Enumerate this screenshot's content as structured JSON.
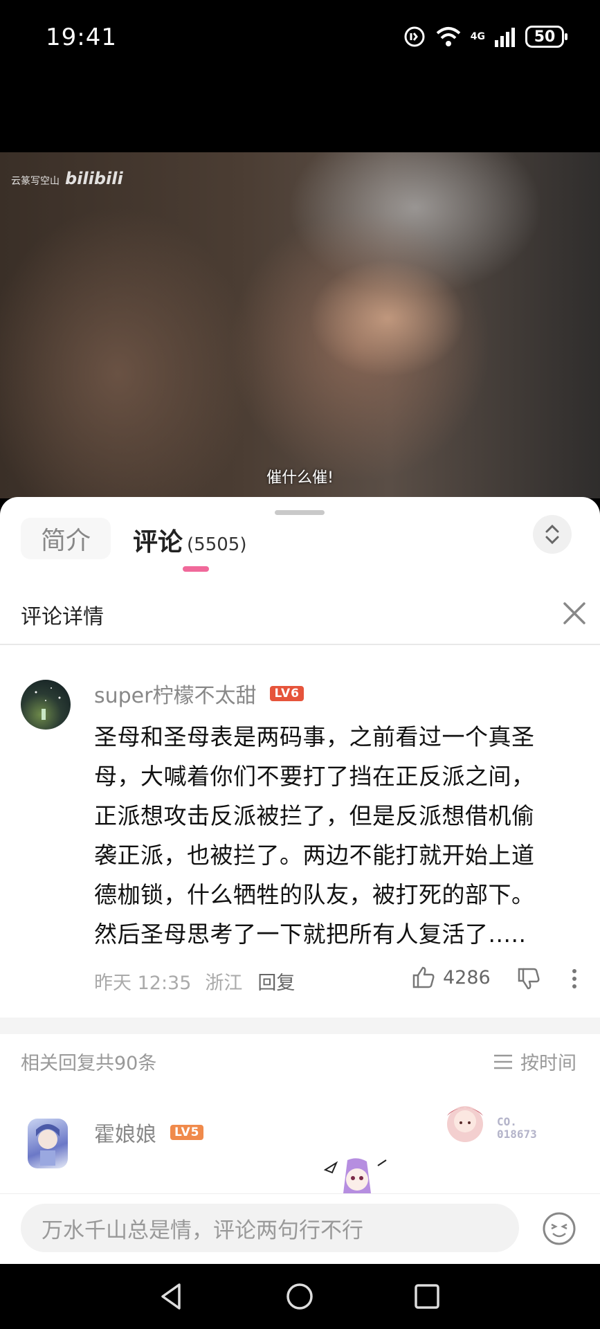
{
  "status_bar": {
    "time": "19:41",
    "battery": "50",
    "network": "4G"
  },
  "video": {
    "watermark_text": "云篆写空山",
    "watermark_logo": "bilibili",
    "subtitle": "催什么催!"
  },
  "tabs": {
    "intro_label": "简介",
    "comments_label": "评论",
    "comments_count": "(5505)"
  },
  "detail_header": {
    "title": "评论详情"
  },
  "main_comment": {
    "username": "super柠檬不太甜",
    "level": "LV6",
    "lines": [
      "圣母和圣母表是两码事，之前看过一个真圣",
      "母，大喊着你们不要打了挡在正反派之间，",
      "正派想攻击反派被拦了，但是反派想借机偷",
      "袭正派，也被拦了。两边不能打就开始上道",
      "德枷锁，什么牺牲的队友，被打死的部下。",
      "然后圣母思考了一下就把所有人复活了....."
    ],
    "time": "昨天 12:35",
    "location": "浙江",
    "reply_label": "回复",
    "likes": "4286"
  },
  "replies": {
    "count_label": "相关回复共90条",
    "sort_label": "按时间",
    "first_reply": {
      "username": "霍娘娘",
      "level": "LV5",
      "badge_code_line1": "CO.",
      "badge_code_line2": "018673"
    }
  },
  "input": {
    "placeholder": "万水千山总是情，评论两句行不行"
  },
  "colors": {
    "accent_pink": "#f0699a",
    "level6": "#e6543b",
    "level5": "#f08a4b"
  }
}
